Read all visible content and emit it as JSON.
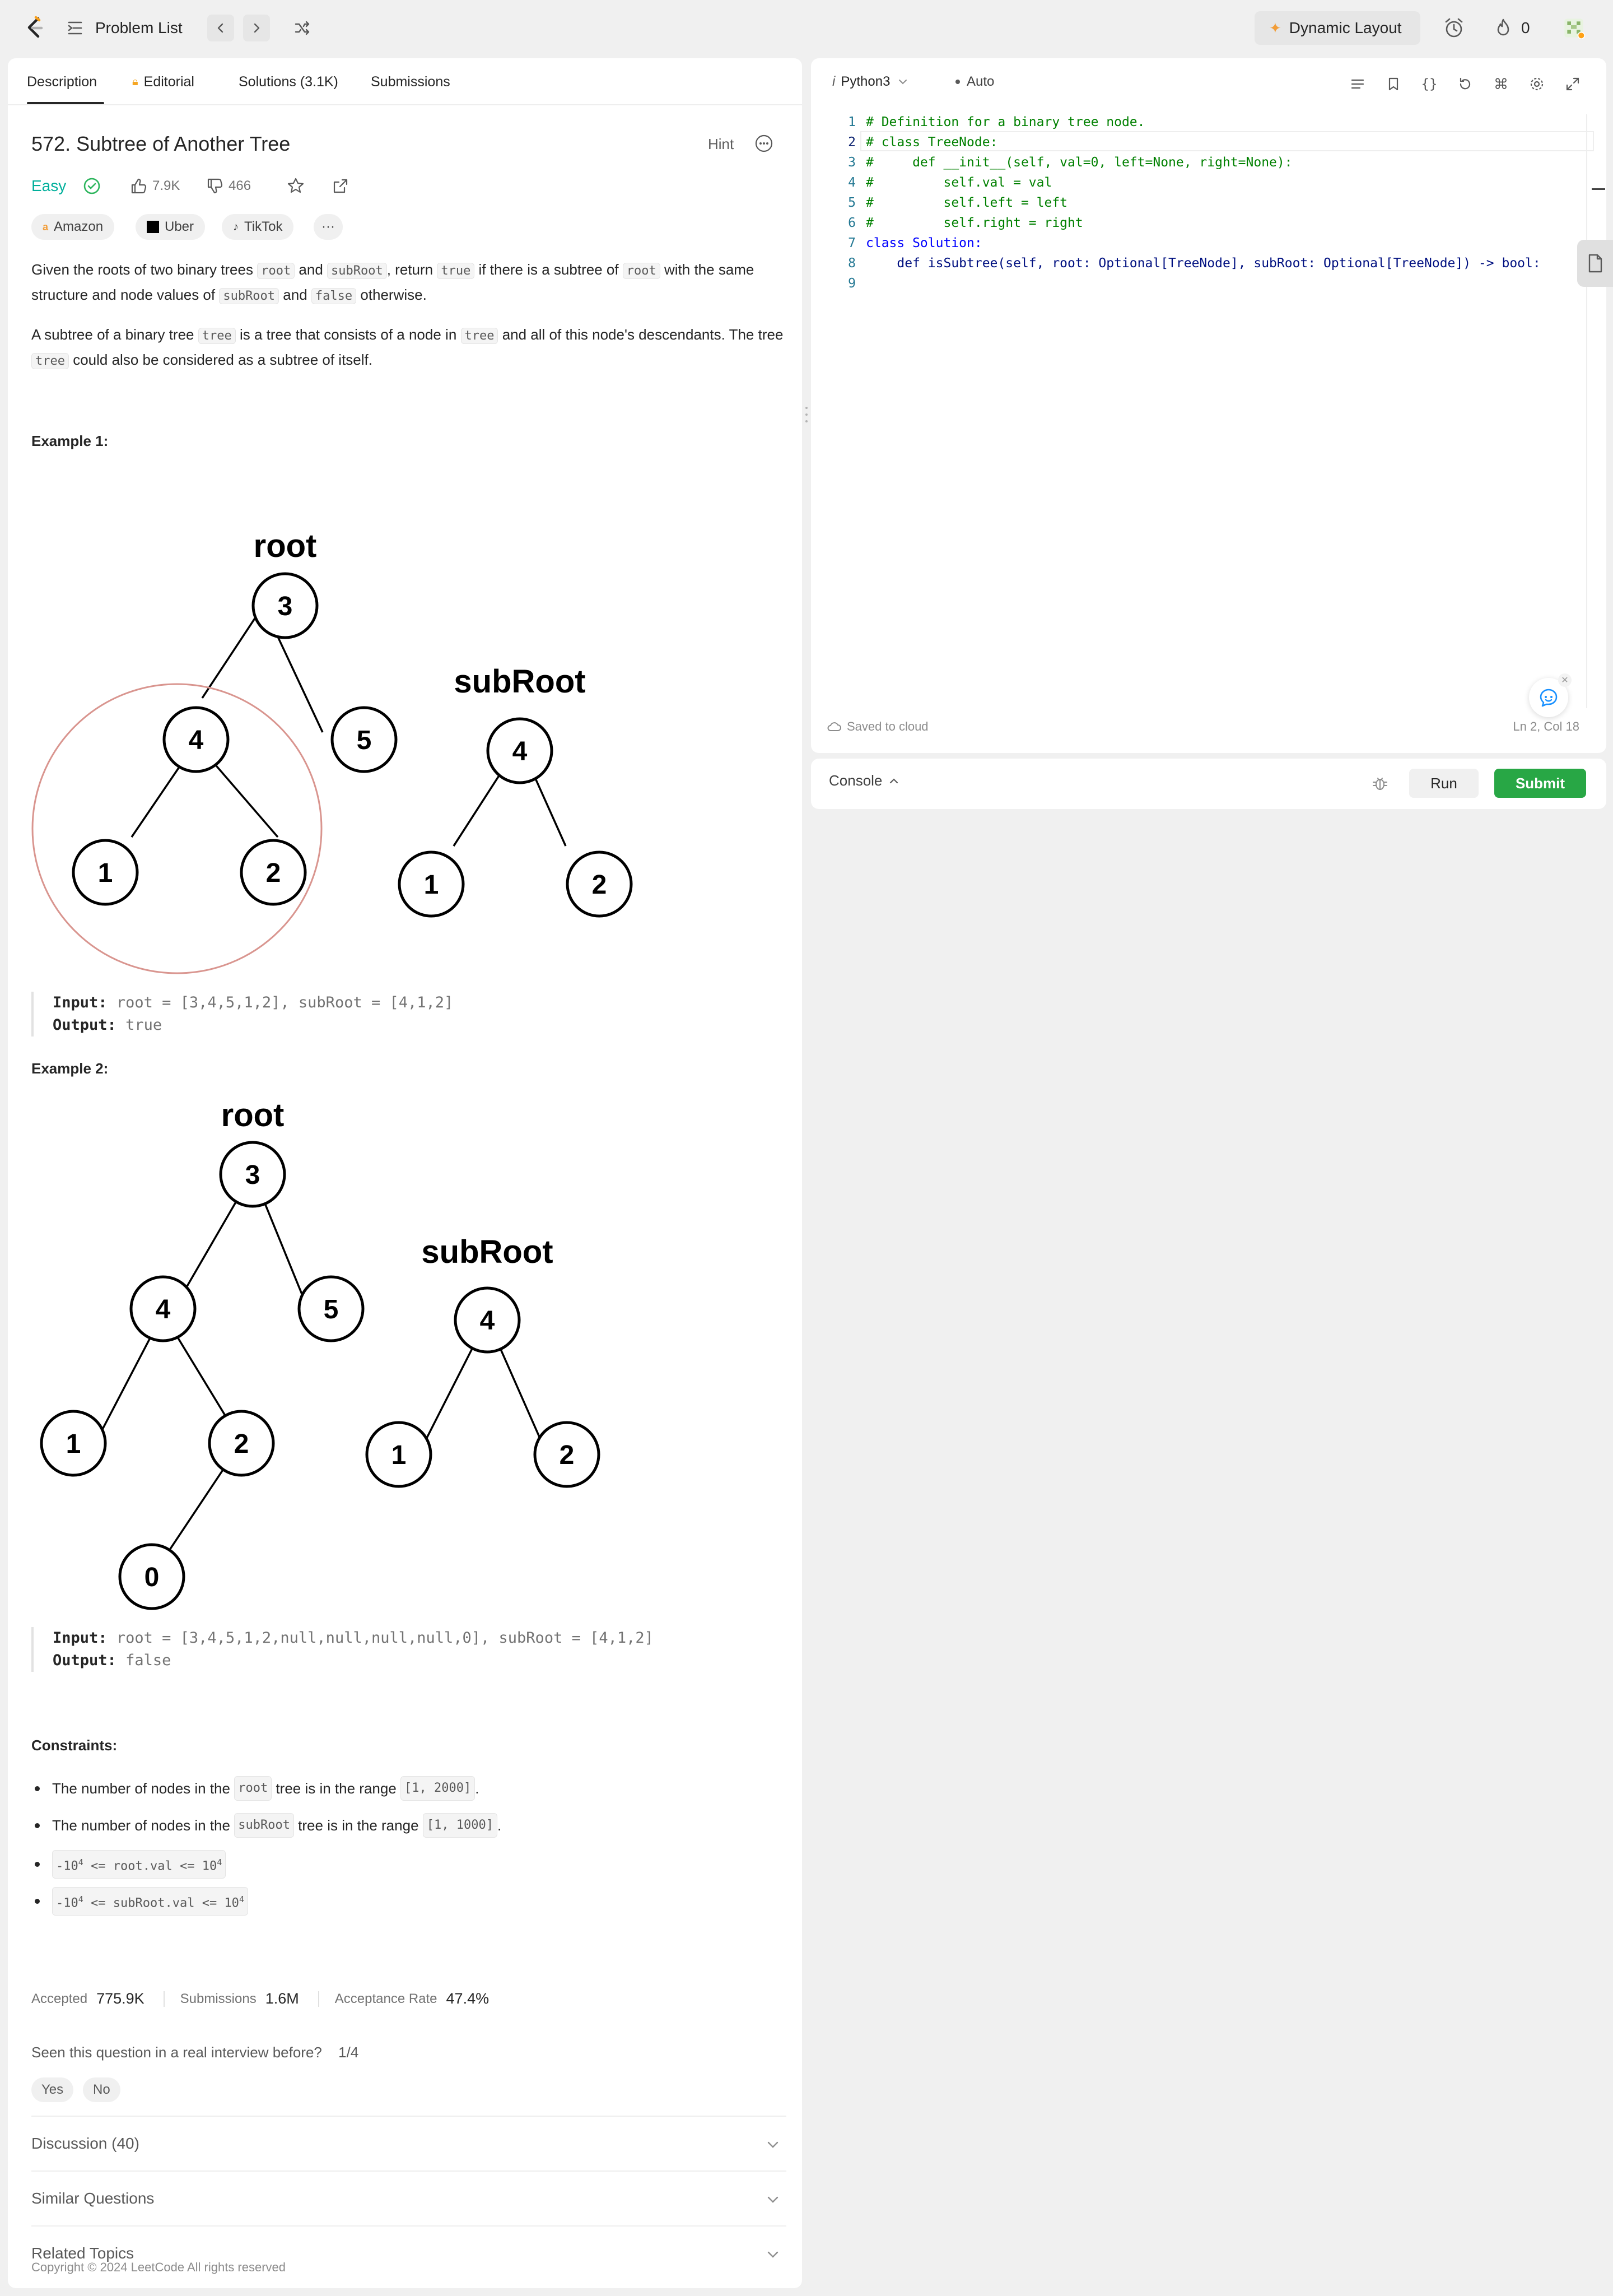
{
  "nav": {
    "problem_list": "Problem List",
    "dynamic_layout": "Dynamic Layout",
    "streak_count": "0"
  },
  "tabs": {
    "description": "Description",
    "editorial": "Editorial",
    "solutions": "Solutions (3.1K)",
    "submissions": "Submissions"
  },
  "problem": {
    "title": "572. Subtree of Another Tree",
    "hint": "Hint",
    "difficulty": "Easy",
    "likes": "7.9K",
    "dislikes": "466",
    "companies": [
      "Amazon",
      "Uber",
      "TikTok"
    ],
    "more": "···",
    "para1": {
      "t1": "Given the roots of two binary trees ",
      "c1": "root",
      "t2": " and ",
      "c2": "subRoot",
      "t3": ", return ",
      "c3": "true",
      "t4": " if there is a subtree of ",
      "c4": "root",
      "t5": " with the same structure and node values of ",
      "c5": "subRoot",
      "t6": " and ",
      "c6": "false",
      "t7": " otherwise."
    },
    "para2": {
      "t1": "A subtree of a binary tree ",
      "c1": "tree",
      "t2": " is a tree that consists of a node in ",
      "c2": "tree",
      "t3": " and all of this node's descendants. The tree ",
      "c3": "tree",
      "t4": " could also be considered as a subtree of itself."
    },
    "example1": {
      "title": "Example 1:",
      "input_label": "Input:",
      "input": "root = [3,4,5,1,2], subRoot = [4,1,2]",
      "output_label": "Output:",
      "output": "true",
      "root_label": "root",
      "subroot_label": "subRoot",
      "root_nodes": [
        "3",
        "4",
        "5",
        "1",
        "2"
      ],
      "sub_nodes": [
        "4",
        "1",
        "2"
      ]
    },
    "example2": {
      "title": "Example 2:",
      "input_label": "Input:",
      "input": "root = [3,4,5,1,2,null,null,null,null,0], subRoot = [4,1,2]",
      "output_label": "Output:",
      "output": "false",
      "root_label": "root",
      "subroot_label": "subRoot",
      "root_nodes": [
        "3",
        "4",
        "5",
        "1",
        "2",
        "0"
      ],
      "sub_nodes": [
        "4",
        "1",
        "2"
      ]
    },
    "constraints_title": "Constraints:",
    "constraints": {
      "c1a": "The number of nodes in the ",
      "c1b": "root",
      "c1c": " tree is in the range ",
      "c1d": "[1, 2000]",
      "c1e": ".",
      "c2a": "The number of nodes in the ",
      "c2b": "subRoot",
      "c2c": " tree is in the range ",
      "c2d": "[1, 1000]",
      "c2e": ".",
      "c3a": "-10",
      "c3b": "4",
      "c3c": " <= root.val <= 10",
      "c3d": "4",
      "c4a": "-10",
      "c4b": "4",
      "c4c": " <= subRoot.val <= 10",
      "c4d": "4"
    },
    "stats": {
      "accepted_label": "Accepted",
      "accepted": "775.9K",
      "submissions_label": "Submissions",
      "submissions": "1.6M",
      "rate_label": "Acceptance Rate",
      "rate": "47.4%"
    },
    "seen": "Seen this question in a real interview before?",
    "seen_count": "1/4",
    "yes": "Yes",
    "no": "No",
    "discussion": "Discussion (40)",
    "similar": "Similar Questions",
    "related": "Related Topics",
    "copyright": "Copyright © 2024 LeetCode All rights reserved"
  },
  "editor": {
    "language": "Python3",
    "mode": "Auto",
    "lines": [
      "# Definition for a binary tree node.",
      "# class TreeNode:",
      "#     def __init__(self, val=0, left=None, right=None):",
      "#         self.val = val",
      "#         self.left = left",
      "#         self.right = right",
      "class Solution:",
      "    def isSubtree(self, root: Optional[TreeNode], subRoot: Optional[TreeNode]) -> bool:",
      ""
    ],
    "line_numbers": [
      "1",
      "2",
      "3",
      "4",
      "5",
      "6",
      "7",
      "8",
      "9"
    ],
    "saved": "Saved to cloud",
    "cursor_pos": "Ln 2, Col 18"
  },
  "console": {
    "label": "Console",
    "run": "Run",
    "submit": "Submit"
  },
  "colors": {
    "easy": "#00af9b",
    "submit": "#28a745",
    "highlight_circle": "#d9958f"
  }
}
